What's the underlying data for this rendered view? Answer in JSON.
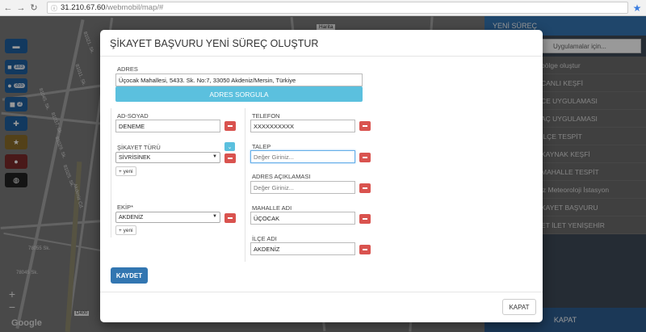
{
  "browser": {
    "host": "31.210.67.60",
    "path": "/webmobil/map/#"
  },
  "map": {
    "attribution": "Google",
    "street_labels": [
      "81045. Sk.",
      "81037. Sk.",
      "81029. Sk.",
      "81025. Sk.",
      "81021. Sk.",
      "81011. Sk.",
      "78055 Sk.",
      "78045 Sk.",
      "Akdeniz Cd.",
      "Harita",
      "D400"
    ]
  },
  "toolbar": {
    "buttons": [
      {
        "icon": "bus-icon",
        "glyph": "▬",
        "count": ""
      },
      {
        "icon": "user-icon",
        "glyph": "■",
        "count": "183"
      },
      {
        "icon": "marker-icon",
        "glyph": "●",
        "count": "355"
      },
      {
        "icon": "comment-icon",
        "glyph": "◼",
        "count": "2"
      },
      {
        "icon": "plus-icon",
        "glyph": "✚",
        "count": ""
      },
      {
        "icon": "star-icon",
        "glyph": "★",
        "count": ""
      },
      {
        "icon": "warning-icon",
        "glyph": "●",
        "count": ""
      },
      {
        "icon": "compass-icon",
        "glyph": "◍",
        "count": ""
      }
    ],
    "zoom_in": "+",
    "zoom_out": "−"
  },
  "right_panel": {
    "header": "YENİ SÜREÇ",
    "search_placeholder": "Uygulamalar için...",
    "items": [
      "bölge oluştur",
      "CANLI KEŞFİ",
      "CE UYGULAMASI",
      "AÇ UYGULAMASI",
      "İLÇE TESPİT",
      "KAYNAK KEŞFİ",
      "MAHALLE TESPİT",
      "iz Meteoroloji İstasyon",
      "KAYET BAŞVURU",
      "ET İLET YENİŞEHİR"
    ],
    "footer": "KAPAT"
  },
  "modal": {
    "title_main": "ŞİKAYET BAŞVURU",
    "title_sub": " YENİ SÜREÇ OLUŞTUR",
    "address": {
      "label": "ADRES",
      "value": "Üçocak Mahallesi, 5433. Sk. No:7, 33050 Akdeniz/Mersin, Türkiye",
      "query_button": "ADRES SORGULA"
    },
    "fields": {
      "ad_soyad": {
        "label": "AD-SOYAD",
        "value": "DENEME"
      },
      "telefon": {
        "label": "TELEFON",
        "value": "XXXXXXXXXX"
      },
      "sikayet_turu": {
        "label": "ŞİKAYET TÜRÜ",
        "value": "SİVRİSİNEK",
        "add": "+ yeni"
      },
      "talep": {
        "label": "TALEP",
        "placeholder": "Değer Giriniz..."
      },
      "adres_aciklamasi": {
        "label": "ADRES AÇIKLAMASI",
        "placeholder": "Değer Giriniz..."
      },
      "ekip": {
        "label": "EKİP*",
        "value": "AKDENİZ",
        "add": "+ yeni"
      },
      "mahalle_adi": {
        "label": "MAHALLE ADI",
        "value": "ÜÇOCAK"
      },
      "ilce_adi": {
        "label": "İLÇE ADI",
        "value": "AKDENİZ"
      }
    },
    "save_button": "KAYDET",
    "close_button": "KAPAT"
  }
}
